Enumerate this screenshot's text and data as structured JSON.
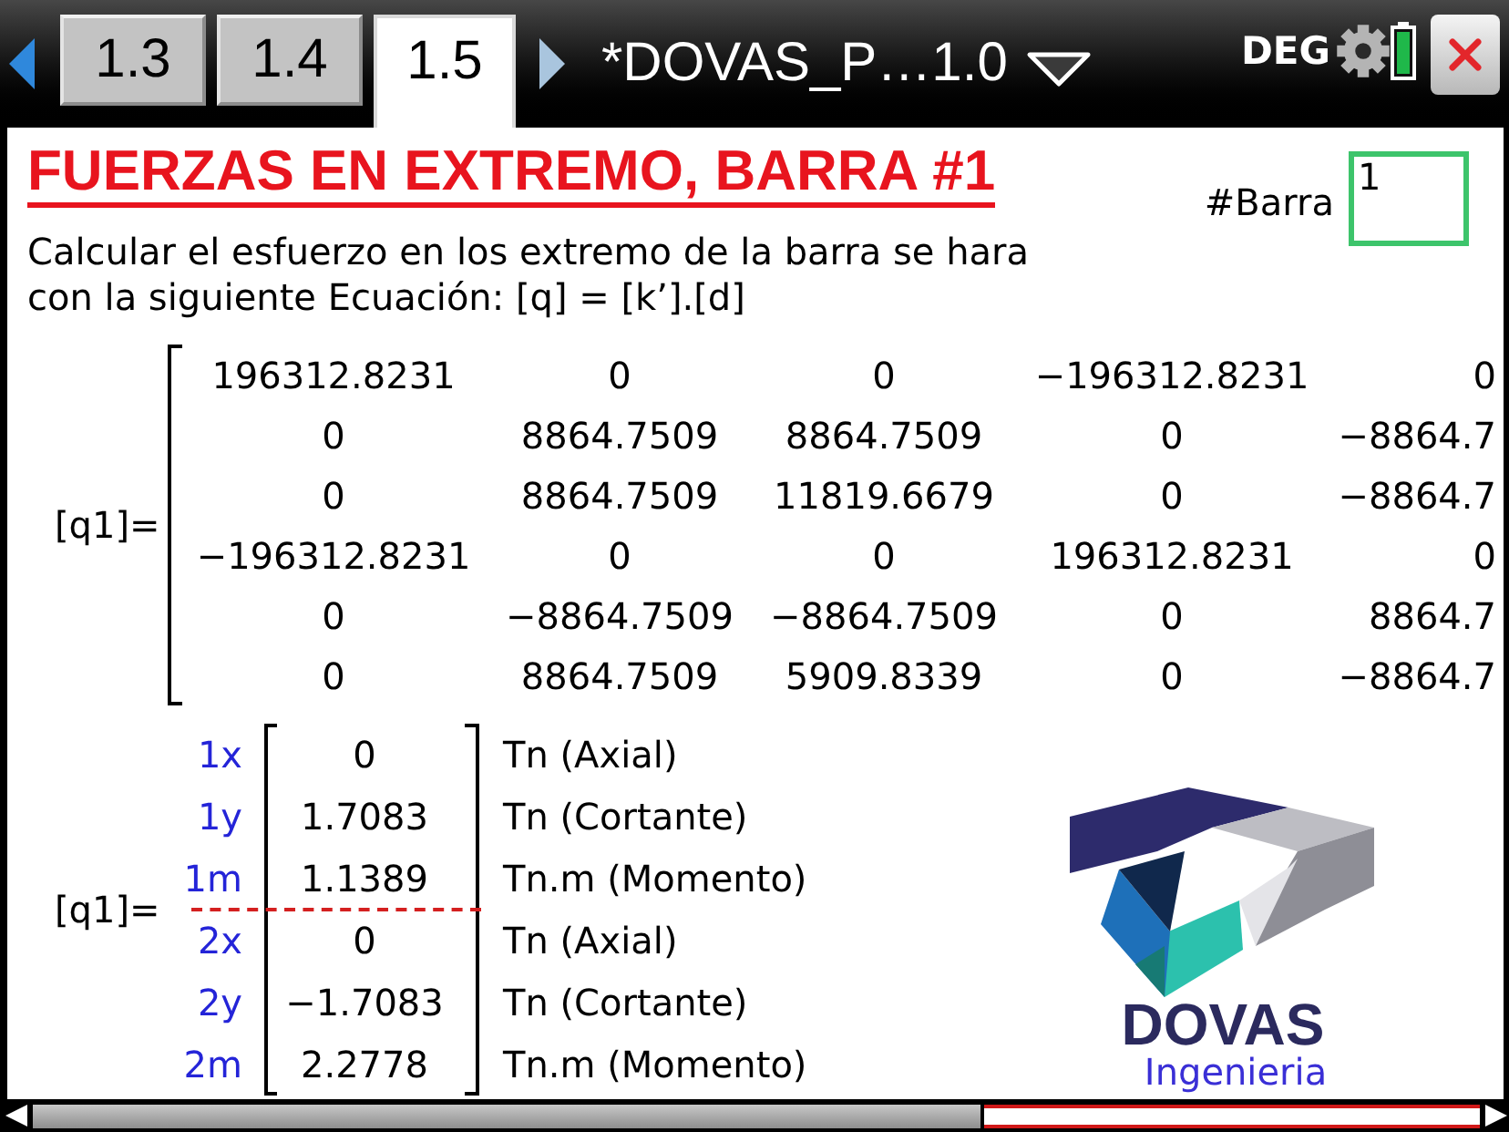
{
  "tab_bar": {
    "tabs": [
      {
        "label": "1.3",
        "selected": false
      },
      {
        "label": "1.4",
        "selected": false
      },
      {
        "label": "1.5",
        "selected": true
      }
    ],
    "document_title": "*DOVAS_P…1.0",
    "angle_mode": "DEG"
  },
  "header": {
    "title": "FUERZAS EN EXTREMO, BARRA #1",
    "description": "Calcular el esfuerzo en los extremo de la barra se hara\ncon la siguiente Ecuación: [q] = [k’].[d]",
    "bar_field": {
      "label": "#Barra",
      "value": "1"
    }
  },
  "stiffness_matrix": {
    "label": "[q1]=",
    "rows": [
      [
        "196312.8231",
        "0",
        "0",
        "−196312.8231",
        "0"
      ],
      [
        "0",
        "8864.7509",
        "8864.7509",
        "0",
        "−8864.7"
      ],
      [
        "0",
        "8864.7509",
        "11819.6679",
        "0",
        "−8864.7"
      ],
      [
        "−196312.8231",
        "0",
        "0",
        "196312.8231",
        "0"
      ],
      [
        "0",
        "−8864.7509",
        "−8864.7509",
        "0",
        "8864.7"
      ],
      [
        "0",
        "8864.7509",
        "5909.8339",
        "0",
        "−8864.7"
      ]
    ]
  },
  "force_vector": {
    "label": "[q1]=",
    "nodes": [
      {
        "rows": [
          {
            "dof": "1x",
            "value": "0",
            "unit": "Tn (Axial)"
          },
          {
            "dof": "1y",
            "value": "1.7083",
            "unit": "Tn (Cortante)"
          },
          {
            "dof": "1m",
            "value": "1.1389",
            "unit": "Tn.m (Momento)"
          }
        ]
      },
      {
        "rows": [
          {
            "dof": "2x",
            "value": "0",
            "unit": "Tn (Axial)"
          },
          {
            "dof": "2y",
            "value": "−1.7083",
            "unit": "Tn (Cortante)"
          },
          {
            "dof": "2m",
            "value": "2.2778",
            "unit": "Tn.m (Momento)"
          }
        ]
      }
    ]
  },
  "logo": {
    "name": "DOVAS",
    "subtitle": "Ingenieria"
  }
}
